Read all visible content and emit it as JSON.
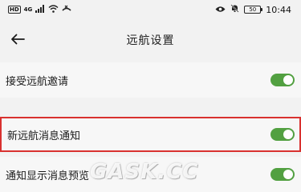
{
  "status_bar": {
    "hd_badge": "HD",
    "signal_text": "4G",
    "battery": "50",
    "time": "10:44"
  },
  "header": {
    "title": "远航设置",
    "back_icon": "arrow-left-icon"
  },
  "settings": [
    {
      "label": "接受远航邀请",
      "enabled": true
    },
    {
      "label": "新远航消息通知",
      "enabled": true,
      "highlighted": true
    },
    {
      "label": "通知显示消息预览",
      "enabled": true
    }
  ],
  "watermark": "GASK.CC",
  "colors": {
    "toggle_on": "#52a041",
    "highlight_border": "#d9312f",
    "background": "#f2f2f2"
  }
}
